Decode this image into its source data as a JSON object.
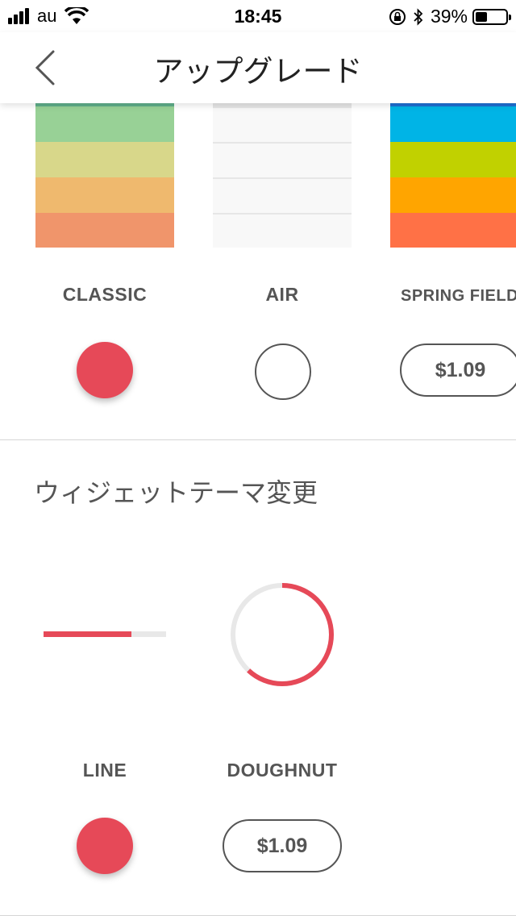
{
  "status_bar": {
    "carrier": "au",
    "time": "18:45",
    "battery_percent": "39%",
    "battery_level": 0.39
  },
  "nav": {
    "back_icon": "chevron-left-icon",
    "title": "アップグレード"
  },
  "app_themes": [
    {
      "label": "CLASSIC",
      "state": "selected",
      "band_colors": [
        "#5fad8a",
        "#98d196",
        "#d8d78a",
        "#efb96e",
        "#f0956b"
      ]
    },
    {
      "label": "AIR",
      "state": "unselected",
      "band_colors": [
        "#e5e5e5",
        "#f8f8f8",
        "#f8f8f8",
        "#f8f8f8",
        "#f8f8f8"
      ]
    },
    {
      "label": "SPRING FIELD",
      "state": "locked",
      "price": "$1.09",
      "band_colors": [
        "#1f6fd1",
        "#00b4e6",
        "#c1d100",
        "#ffa500",
        "#ff7146"
      ]
    }
  ],
  "widget_section": {
    "title": "ウィジェットテーマ変更",
    "themes": [
      {
        "label": "LINE",
        "state": "selected",
        "progress": 0.72
      },
      {
        "label": "DOUGHNUT",
        "state": "locked",
        "price": "$1.09",
        "progress": 0.62
      }
    ]
  },
  "colors": {
    "accent": "#e64958",
    "track": "#e8e8e8",
    "text_gray": "#555555"
  }
}
